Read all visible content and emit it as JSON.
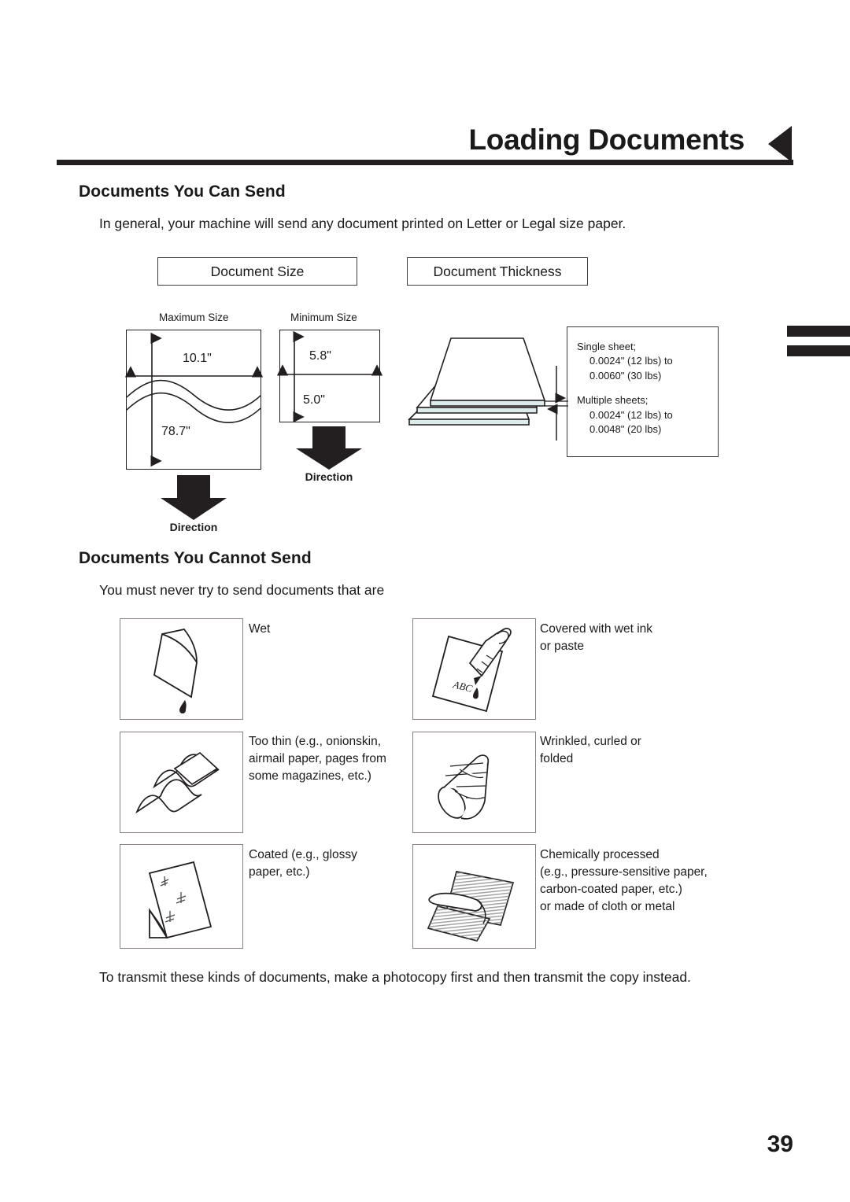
{
  "header": {
    "chapter_title": "Loading Documents",
    "arrow_icon": "left-triangle-icon"
  },
  "sections": {
    "can_send": {
      "heading": "Documents You Can Send",
      "intro": "In general, your machine will send any document printed on Letter or Legal size paper."
    },
    "cannot_send": {
      "heading": "Documents You Cannot Send",
      "intro": "You must never try to send documents that are",
      "closing": "To transmit these kinds of documents, make a photocopy first and then transmit the copy instead."
    }
  },
  "document_size": {
    "panel_label": "Document Size",
    "maximum": {
      "caption": "Maximum Size",
      "width": "10.1\"",
      "height": "78.7\""
    },
    "minimum": {
      "caption": "Minimum Size",
      "width": "5.8\"",
      "height": "5.0\""
    },
    "direction_label_max": "Direction",
    "direction_label_min": "Direction"
  },
  "document_thickness": {
    "panel_label": "Document Thickness",
    "note": {
      "single_title": "Single sheet;",
      "single_line1": "0.0024\" (12 lbs) to",
      "single_line2": "0.0060\" (30 lbs)",
      "multiple_title": "Multiple sheets;",
      "multiple_line1": "0.0024\" (12 lbs) to",
      "multiple_line2": "0.0048\" (20 lbs)"
    }
  },
  "cannot_send_items": [
    {
      "icon": "wet-paper-icon",
      "text": "Wet"
    },
    {
      "icon": "pen-ink-paper-icon",
      "text": "Covered with wet ink\nor paste"
    },
    {
      "icon": "thin-wavy-paper-icon",
      "text": "Too thin  (e.g.,  onionskin,\nairmail paper, pages from\nsome magazines, etc.)"
    },
    {
      "icon": "wrinkled-curled-paper-icon",
      "text": "Wrinkled, curled or\nfolded"
    },
    {
      "icon": "glossy-coated-paper-icon",
      "text": "Coated (e.g., glossy\npaper, etc.)"
    },
    {
      "icon": "carbon-copy-paper-icon",
      "text": "Chemically processed\n(e.g., pressure-sensitive paper,\ncarbon-coated paper, etc.)\nor made of cloth or metal"
    }
  ],
  "illustration_labels": {
    "abc_text": "ABC"
  },
  "footer": {
    "page_number": "39"
  },
  "colors": {
    "ink": "#231f20",
    "box_border": "#8a7f82",
    "panel_border": "#3d3d3d",
    "sheet_edge": "#dcecec"
  }
}
